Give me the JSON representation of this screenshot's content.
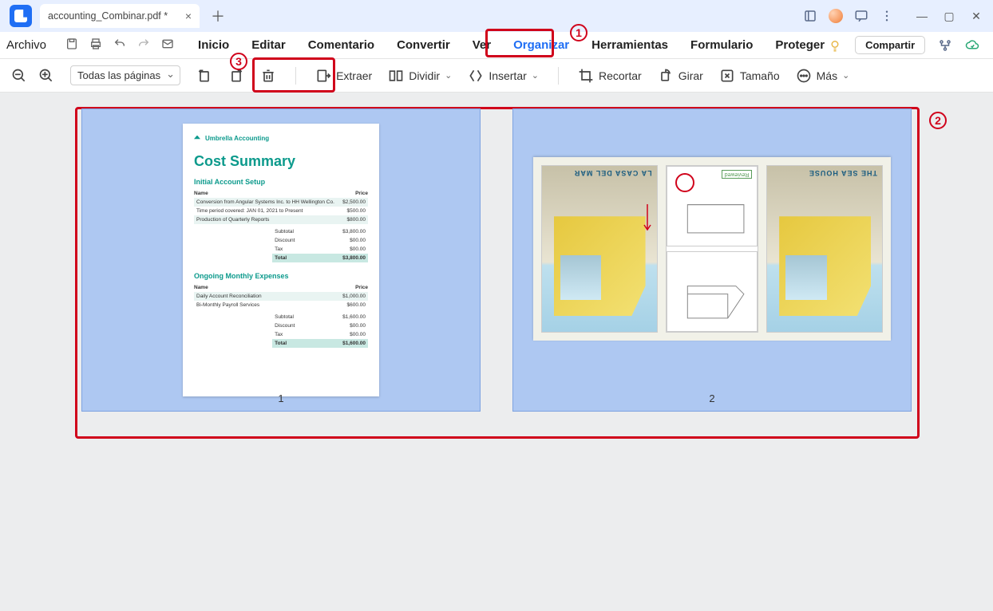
{
  "titlebar": {
    "tab_title": "accounting_Combinar.pdf *"
  },
  "menubar": {
    "file": "Archivo",
    "items": [
      "Inicio",
      "Editar",
      "Comentario",
      "Convertir",
      "Ver",
      "Organizar",
      "Herramientas",
      "Formulario",
      "Proteger"
    ],
    "active_index": 5,
    "share": "Compartir"
  },
  "toolbar": {
    "page_select": "Todas las páginas",
    "extract": "Extraer",
    "split": "Dividir",
    "insert": "Insertar",
    "crop": "Recortar",
    "rotate": "Girar",
    "size": "Tamaño",
    "more": "Más"
  },
  "annotations": {
    "one": "1",
    "two": "2",
    "three": "3"
  },
  "pages": {
    "p1_num": "1",
    "p2_num": "2"
  },
  "doc1": {
    "brand": "Umbrella Accounting",
    "title": "Cost Summary",
    "section1": "Initial Account Setup",
    "col_name": "Name",
    "col_price": "Price",
    "rows1": [
      {
        "name": "Conversion from Angular Systems Inc. to HH Wellington Co.",
        "price": "$2,500.00"
      },
      {
        "name": "Time period covered: JAN 01, 2021 to Present",
        "price": "$500.00"
      },
      {
        "name": "Production of Quarterly Reports",
        "price": "$800.00"
      }
    ],
    "sub1": [
      {
        "label": "Subtotal",
        "val": "$3,800.00"
      },
      {
        "label": "Discount",
        "val": "$00.00"
      },
      {
        "label": "Tax",
        "val": "$00.00"
      },
      {
        "label": "Total",
        "val": "$3,800.00"
      }
    ],
    "section2": "Ongoing Monthly Expenses",
    "rows2": [
      {
        "name": "Daily Account Reconciliation",
        "price": "$1,000.00"
      },
      {
        "name": "Bi-Monthly Payroll Services",
        "price": "$600.00"
      }
    ],
    "sub2": [
      {
        "label": "Subtotal",
        "val": "$1,600.00"
      },
      {
        "label": "Discount",
        "val": "$00.00"
      },
      {
        "label": "Tax",
        "val": "$00.00"
      },
      {
        "label": "Total",
        "val": "$1,600.00"
      }
    ]
  },
  "doc2": {
    "title_left": "LA CASA DEL MAR",
    "title_right": "THE SEA HOUSE",
    "reviewed": "Reviewed"
  }
}
